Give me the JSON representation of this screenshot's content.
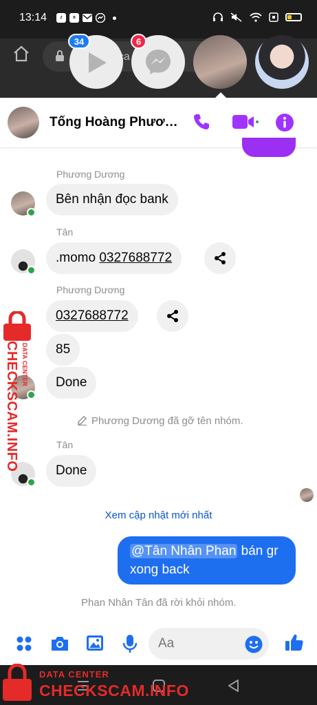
{
  "status_bar": {
    "time": "13:14",
    "icons_left": [
      "zalo-icon",
      "bidv-icon",
      "mail-icon",
      "messenger-icon"
    ],
    "icons_right": [
      "headset-icon",
      "mute-icon",
      "wifi-icon",
      "screen-icon",
      "battery-icon"
    ]
  },
  "browser": {
    "url_text": "ca"
  },
  "chat_heads": {
    "video_badge": "34",
    "messenger_badge": "6"
  },
  "header": {
    "title": "Tống Hoàng Phương Dương",
    "actions": [
      "phone-icon",
      "video-call-icon",
      "info-icon"
    ],
    "accent": "#a033ff"
  },
  "messages": [
    {
      "sender": "Phương Dương",
      "text": "Bên nhận đọc bank"
    },
    {
      "sender": "Tân",
      "prefix": ".momo ",
      "link": "0327688772"
    },
    {
      "sender": "Phương Dương",
      "link": "0327688772"
    },
    {
      "text": "85"
    },
    {
      "text": "Done"
    },
    {
      "system": "Phương Dương đã gỡ tên nhóm."
    },
    {
      "sender": "Tân",
      "text": "Done"
    },
    {
      "link_latest": "Xem cập nhật mới nhất"
    },
    {
      "outgoing_mention": "@Tân Nhân Phan",
      "outgoing_rest": " bán gr",
      "outgoing_line2": "xong back"
    },
    {
      "system": "Phan Nhân Tân đã rời khỏi nhóm."
    }
  ],
  "composer": {
    "placeholder": "Aa",
    "icons": [
      "apps-icon",
      "camera-icon",
      "gallery-icon",
      "mic-icon",
      "emoji-icon",
      "like-icon"
    ]
  },
  "watermark": {
    "vertical_main": "CHECKSCAM.INFO",
    "vertical_sub": "DATA CENTER",
    "bottom_sub": "DATA CENTER",
    "bottom_main": "CHECKSCAM.INFO",
    "color": "#e52a2a"
  }
}
